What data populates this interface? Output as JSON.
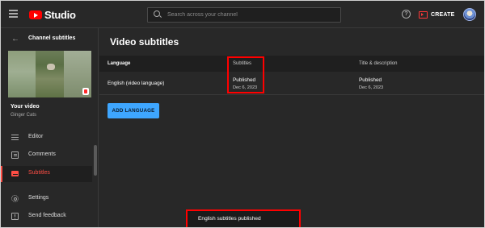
{
  "app": {
    "logo_text": "Studio"
  },
  "search": {
    "placeholder": "Search across your channel"
  },
  "header": {
    "help_glyph": "?",
    "create_label": "CREATE"
  },
  "sidebar": {
    "title": "Channel subtitles",
    "video_label": "Your video",
    "channel_name": "Ginger Cats",
    "items": [
      {
        "label": "Editor",
        "icon": "editor-icon",
        "active": false
      },
      {
        "label": "Comments",
        "icon": "comments-icon",
        "active": false
      },
      {
        "label": "Subtitles",
        "icon": "subtitles-icon",
        "active": true
      },
      {
        "label": "Settings",
        "icon": "gear-icon",
        "active": false
      },
      {
        "label": "Send feedback",
        "icon": "feedback-icon",
        "active": false
      }
    ]
  },
  "main": {
    "title": "Video subtitles",
    "columns": [
      "Language",
      "Subtitles",
      "Title & description"
    ],
    "rows": [
      {
        "language": "English (video language)",
        "subtitles_status": "Published",
        "subtitles_date": "Dec 6, 2023",
        "title_status": "Published",
        "title_date": "Dec 6, 2023"
      }
    ],
    "add_language_label": "ADD LANGUAGE"
  },
  "toast": {
    "text": "English subtitles published"
  },
  "colors": {
    "accent_red": "#ff0000",
    "active_nav": "#ff4e45",
    "button_blue": "#3ea6ff",
    "background": "#282828"
  }
}
